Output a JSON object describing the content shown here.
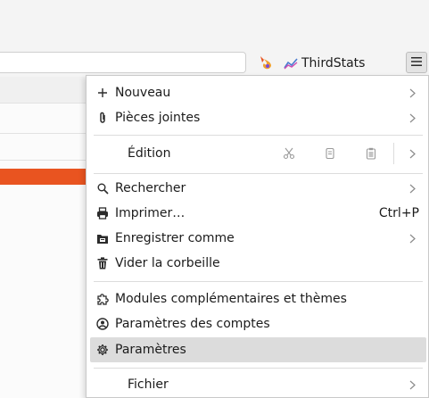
{
  "toolbar": {
    "addon_icon": "flame-icon",
    "thirdstats_label": "ThirdStats",
    "thirdstats_icon": "stats-icon",
    "menu_icon": "hamburger-icon"
  },
  "menu": {
    "items": [
      {
        "label": "Nouveau",
        "icon": "plus-icon",
        "has_submenu": true
      },
      {
        "label": "Pièces jointes",
        "icon": "paperclip-icon",
        "has_submenu": true
      },
      {
        "label": "Édition",
        "icon": "",
        "has_submenu": true,
        "tools": [
          "cut-icon",
          "copy-icon",
          "paste-icon"
        ]
      },
      {
        "label": "Rechercher",
        "icon": "search-icon",
        "has_submenu": true
      },
      {
        "label": "Imprimer…",
        "icon": "printer-icon",
        "shortcut": "Ctrl+P"
      },
      {
        "label": "Enregistrer comme",
        "icon": "save-folder-icon",
        "has_submenu": true
      },
      {
        "label": "Vider la corbeille",
        "icon": "trash-icon"
      },
      {
        "label": "Modules complémentaires et thèmes",
        "icon": "puzzle-icon"
      },
      {
        "label": "Paramètres des comptes",
        "icon": "account-settings-icon"
      },
      {
        "label": "Paramètres",
        "icon": "gear-icon",
        "hovered": true
      },
      {
        "label": "Fichier",
        "icon": "",
        "has_submenu": true
      }
    ]
  },
  "colors": {
    "accent": "#e95420",
    "hover": "#dcdcdc",
    "menu_bg": "#ffffff"
  }
}
